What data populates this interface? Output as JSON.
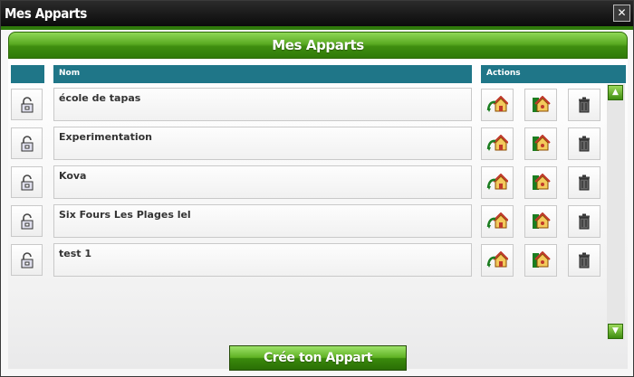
{
  "window": {
    "title": "Mes Apparts",
    "close_glyph": "✕"
  },
  "header": {
    "title": "Mes Apparts"
  },
  "table": {
    "columns": {
      "lock": "",
      "name": "Nom",
      "actions": "Actions"
    },
    "rows": [
      {
        "name": "école de tapas"
      },
      {
        "name": "Experimentation"
      },
      {
        "name": "Kova"
      },
      {
        "name": "Six Fours Les Plages lel"
      },
      {
        "name": "test 1"
      }
    ]
  },
  "icons": {
    "lock": "padlock-open-icon",
    "enter": "enter-room-icon",
    "room_settings": "room-settings-icon",
    "delete": "trash-icon",
    "scroll_up": "scroll-up-arrow-icon",
    "scroll_down": "scroll-down-arrow-icon"
  },
  "footer": {
    "create_label": "Crée ton Appart"
  },
  "colors": {
    "green": "#3f8d10",
    "table_header": "#1f7688",
    "titlebar": "#111111"
  }
}
